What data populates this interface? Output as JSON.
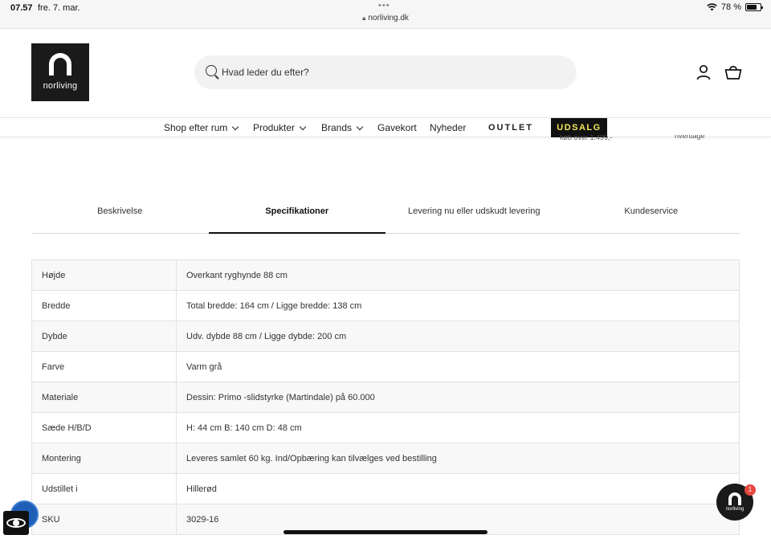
{
  "status_bar": {
    "time": "07.57",
    "date": "fre. 7. mar.",
    "url": "norliving.dk",
    "battery": "78 %",
    "battery_level": 0.78
  },
  "header": {
    "logo_text": "norliving",
    "search_placeholder": "Hvad leder du efter?"
  },
  "nav": {
    "items": [
      {
        "label": "Shop efter rum",
        "has_dropdown": true
      },
      {
        "label": "Produkter",
        "has_dropdown": true
      },
      {
        "label": "Brands",
        "has_dropdown": true
      },
      {
        "label": "Gavekort",
        "has_dropdown": false
      },
      {
        "label": "Nyheder",
        "has_dropdown": false
      },
      {
        "label": "OUTLET",
        "has_dropdown": false
      }
    ],
    "sale_label": "UDSALG",
    "sale_text_color": "#f2e75a",
    "peek_text_left": "køb over 1.499,-",
    "peek_text_right": "hverdage"
  },
  "tabs": [
    {
      "label": "Beskrivelse",
      "active": false
    },
    {
      "label": "Specifikationer",
      "active": true
    },
    {
      "label": "Levering nu eller udskudt levering",
      "active": false
    },
    {
      "label": "Kundeservice",
      "active": false
    }
  ],
  "specs": [
    {
      "key": "Højde",
      "value": "Overkant ryghynde 88 cm"
    },
    {
      "key": "Bredde",
      "value": "Total bredde: 164 cm / Ligge bredde: 138 cm"
    },
    {
      "key": "Dybde",
      "value": "Udv. dybde 88 cm / Ligge dybde: 200 cm"
    },
    {
      "key": "Farve",
      "value": "Varm grå"
    },
    {
      "key": "Materiale",
      "value": "Dessin: Primo -slidstyrke (Martindale) på 60.000"
    },
    {
      "key": "Sæde H/B/D",
      "value": "H: 44 cm B: 140 cm D: 48 cm"
    },
    {
      "key": "Montering",
      "value": "Leveres samlet 60 kg. Ind/Opbæring kan tilvælges ved bestilling"
    },
    {
      "key": "Udstillet i",
      "value": "Hillerød"
    },
    {
      "key": "SKU",
      "value": "3029-16"
    }
  ],
  "chat": {
    "label": "norliving",
    "badge_count": "1",
    "badge_color": "#e5483f"
  }
}
